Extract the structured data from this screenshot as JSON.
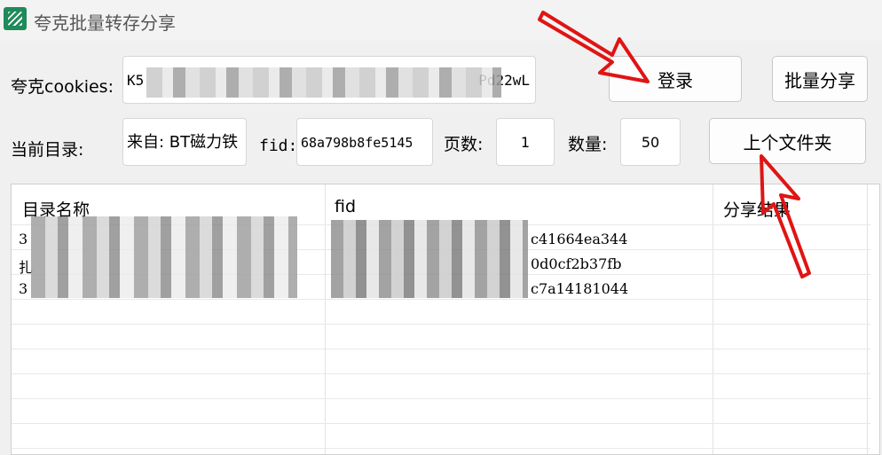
{
  "window": {
    "title": "夸克批量转存分享",
    "icon": "quark-app-icon"
  },
  "cookies": {
    "label": "夸克cookies:",
    "value_start": "K5",
    "value_end": "Pd22wL"
  },
  "login_button": "登录",
  "batch_share_button": "批量分享",
  "dir_row": {
    "label": "当前目录:",
    "dir_value": "来自: BT磁力铁",
    "fid_label": "fid:",
    "fid_value": "68a798b8fe5145",
    "page_label": "页数:",
    "page_value": "1",
    "count_label": "数量:",
    "count_value": "50",
    "parent_button": "上个文件夹"
  },
  "table": {
    "headers": [
      "目录名称",
      "fid",
      "分享结果"
    ],
    "rows": [
      {
        "name_initial": "3",
        "fid_suffix": "c41664ea344",
        "result": ""
      },
      {
        "name_initial": "扎",
        "fid_suffix": "0d0cf2b37fb",
        "result": ""
      },
      {
        "name_initial": "3",
        "fid_suffix": "c7a14181044",
        "result": ""
      }
    ]
  },
  "colors": {
    "arrow": "#e01414",
    "icon_green": "#1f8a5a"
  }
}
